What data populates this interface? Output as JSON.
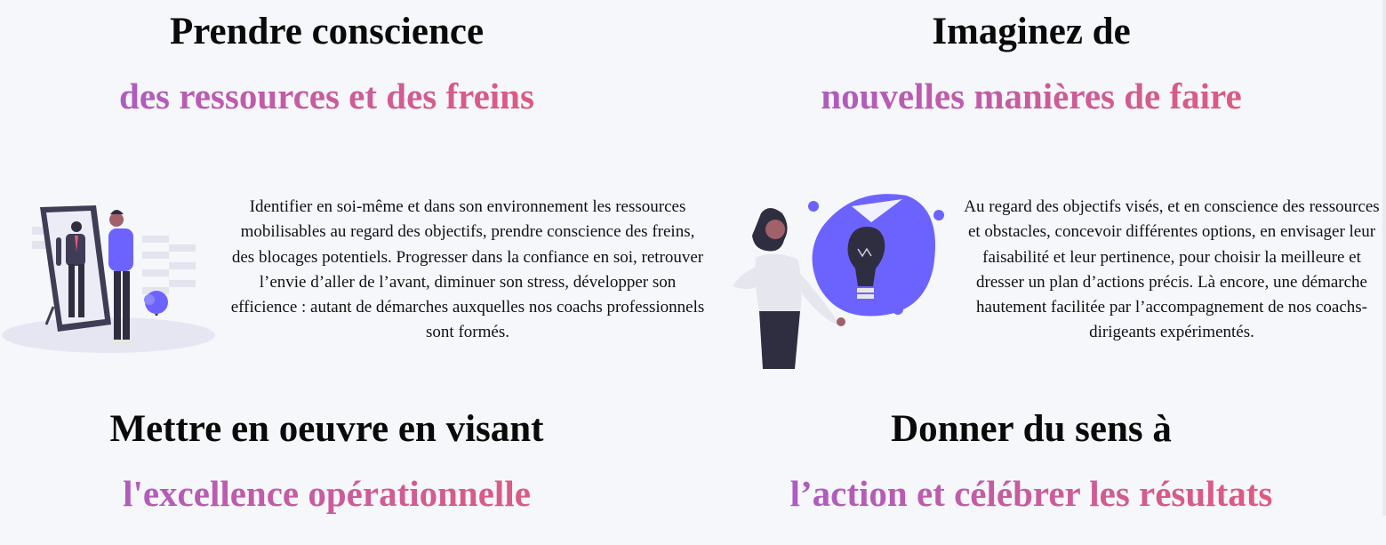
{
  "blocks": [
    {
      "title": "Prendre conscience",
      "subtitle": "des ressources et des freins",
      "text": "Identifier en soi-même et dans son environnement les ressources mobilisables au regard des objectifs, prendre conscience des freins, des blocages potentiels. Progresser dans la confiance en soi, retrouver l’envie d’aller de l’avant, diminuer son stress, développer son efficience : autant de démarches auxquelles nos coachs professionnels sont formés."
    },
    {
      "title": "Imaginez de",
      "subtitle": "nouvelles manières de faire",
      "text": "Au regard des objectifs visés, et en conscience des ressources et obstacles, concevoir différentes options, en envisager leur faisabilité et leur pertinence, pour choisir la meilleure et dresser un plan d’actions précis. Là encore, une démarche hautement facilitée par l’accompagnement de nos coachs-dirigeants expérimentés."
    },
    {
      "title": "Mettre en oeuvre en visant",
      "subtitle": "l'excellence opérationnelle"
    },
    {
      "title": "Donner du sens à",
      "subtitle": "l’action et célébrer les résultats"
    }
  ],
  "illustrations": {
    "left": "mirror-reflection-illustration",
    "right": "woman-lightbulb-idea-illustration"
  },
  "colors": {
    "background": "#f6f7fb",
    "accent_purple": "#6c63ff",
    "gradient_start": "#a65ccc",
    "gradient_end": "#e35a78"
  }
}
